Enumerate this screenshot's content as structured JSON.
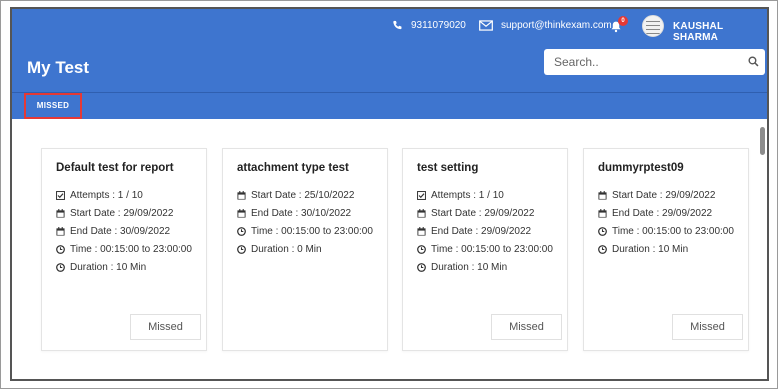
{
  "header": {
    "phone": "9311079020",
    "email": "support@thinkexam.com",
    "notification_count": "0",
    "username": "KAUSHAL SHARMA",
    "page_title": "My Test"
  },
  "search": {
    "placeholder": "Search.."
  },
  "tabs": [
    {
      "label": "MISSED"
    }
  ],
  "cards": [
    {
      "title": "Default test for report",
      "details": [
        {
          "icon": "checkbox-icon",
          "text": "Attempts : 1 / 10"
        },
        {
          "icon": "calendar-icon",
          "text": "Start Date : 29/09/2022"
        },
        {
          "icon": "calendar-icon",
          "text": "End Date : 30/09/2022"
        },
        {
          "icon": "clock-icon",
          "text": "Time : 00:15:00 to 23:00:00"
        },
        {
          "icon": "clock-icon",
          "text": "Duration : 10 Min"
        }
      ],
      "status": "Missed"
    },
    {
      "title": "attachment type test",
      "details": [
        {
          "icon": "calendar-icon",
          "text": "Start Date : 25/10/2022"
        },
        {
          "icon": "calendar-icon",
          "text": "End Date : 30/10/2022"
        },
        {
          "icon": "clock-icon",
          "text": "Time : 00:15:00 to 23:00:00"
        },
        {
          "icon": "clock-icon",
          "text": "Duration : 0 Min"
        }
      ],
      "status": ""
    },
    {
      "title": "test setting",
      "details": [
        {
          "icon": "checkbox-icon",
          "text": "Attempts : 1 / 10"
        },
        {
          "icon": "calendar-icon",
          "text": "Start Date : 29/09/2022"
        },
        {
          "icon": "calendar-icon",
          "text": "End Date : 29/09/2022"
        },
        {
          "icon": "clock-icon",
          "text": "Time : 00:15:00 to 23:00:00"
        },
        {
          "icon": "clock-icon",
          "text": "Duration : 10 Min"
        }
      ],
      "status": "Missed"
    },
    {
      "title": "dummyrptest09",
      "details": [
        {
          "icon": "calendar-icon",
          "text": "Start Date : 29/09/2022"
        },
        {
          "icon": "calendar-icon",
          "text": "End Date : 29/09/2022"
        },
        {
          "icon": "clock-icon",
          "text": "Time : 00:15:00 to 23:00:00"
        },
        {
          "icon": "clock-icon",
          "text": "Duration : 10 Min"
        }
      ],
      "status": "Missed"
    }
  ],
  "colors": {
    "header_bg": "#3e75cf",
    "highlight": "#e53935"
  }
}
